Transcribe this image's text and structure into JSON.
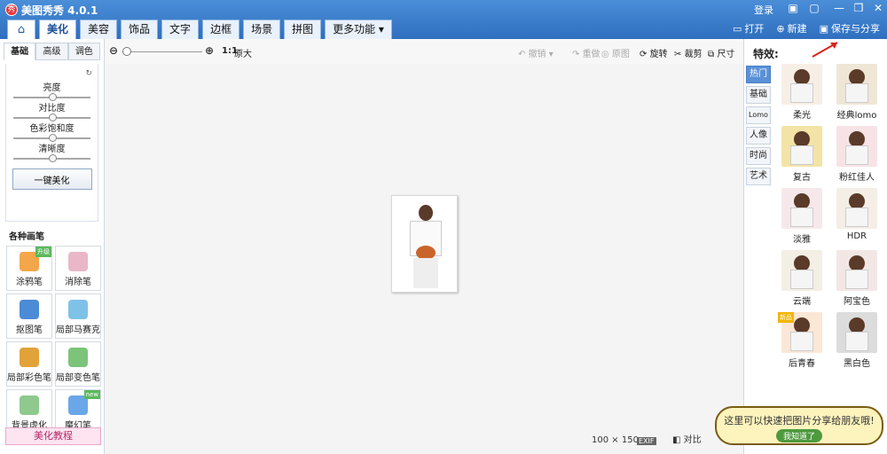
{
  "app": {
    "title": "美图秀秀 4.0.1",
    "logo_char": "秀"
  },
  "titlebar": {
    "login": "登录",
    "controls": [
      "▣",
      "▢",
      "—",
      "❐",
      "✕"
    ]
  },
  "tabs": [
    {
      "label": "美化"
    },
    {
      "label": "美容"
    },
    {
      "label": "饰品"
    },
    {
      "label": "文字"
    },
    {
      "label": "边框"
    },
    {
      "label": "场景"
    },
    {
      "label": "拼图"
    },
    {
      "label": "更多功能 ▾"
    }
  ],
  "actions": {
    "open": "打开",
    "new": "新建",
    "save_share": "保存与分享"
  },
  "left": {
    "subtabs": [
      "基础",
      "高级",
      "调色"
    ],
    "sliders": [
      "亮度",
      "对比度",
      "色彩饱和度",
      "清晰度"
    ],
    "oneclick": "一键美化",
    "pens_title": "各种画笔",
    "pens": [
      {
        "label": "涂鸦笔",
        "badge": "升级",
        "color": "#f3a64a"
      },
      {
        "label": "消除笔",
        "badge": "",
        "color": "#e9b7c8"
      },
      {
        "label": "抠图笔",
        "badge": "",
        "color": "#4c8bd6"
      },
      {
        "label": "局部马赛克",
        "badge": "",
        "color": "#7fc2e8"
      },
      {
        "label": "局部彩色笔",
        "badge": "",
        "color": "#e2a23a"
      },
      {
        "label": "局部变色笔",
        "badge": "",
        "color": "#7cc47a"
      },
      {
        "label": "背景虚化",
        "badge": "",
        "color": "#8fc98d"
      },
      {
        "label": "魔幻笔",
        "badge": "new",
        "color": "#6aa7e8"
      }
    ],
    "tutorial": "美化教程"
  },
  "toolbar": {
    "ratio": "1:1",
    "original": "原大",
    "undo": "撤销",
    "redo": "重做",
    "reset": "原图",
    "rotate": "旋转",
    "crop": "裁剪",
    "size": "尺寸"
  },
  "status": {
    "width": "100",
    "x": "×",
    "height": "150",
    "exif": "EXIF",
    "compare": "对比"
  },
  "effects": {
    "title": "特效:",
    "tabs": [
      "热门",
      "基础",
      "Lomo",
      "人像",
      "时尚",
      "艺术"
    ],
    "items": [
      {
        "label": "柔光",
        "bg": "#f7efe6"
      },
      {
        "label": "经典lomo",
        "bg": "#efe6d6"
      },
      {
        "label": "复古",
        "bg": "#f3e3a6"
      },
      {
        "label": "粉红佳人",
        "bg": "#f7e3e6"
      },
      {
        "label": "淡雅",
        "bg": "#f6e8ea"
      },
      {
        "label": "HDR",
        "bg": "#f5eee6"
      },
      {
        "label": "云端",
        "bg": "#f3efe4"
      },
      {
        "label": "阿宝色",
        "bg": "#f3e7e6"
      },
      {
        "label": "后青春",
        "bg": "#fbe7d6",
        "tag": "新品"
      },
      {
        "label": "黑白色",
        "bg": "#dcdcdc"
      }
    ]
  },
  "callout": {
    "text": "这里可以快速把图片分享给朋友哦!",
    "button": "我知道了"
  }
}
